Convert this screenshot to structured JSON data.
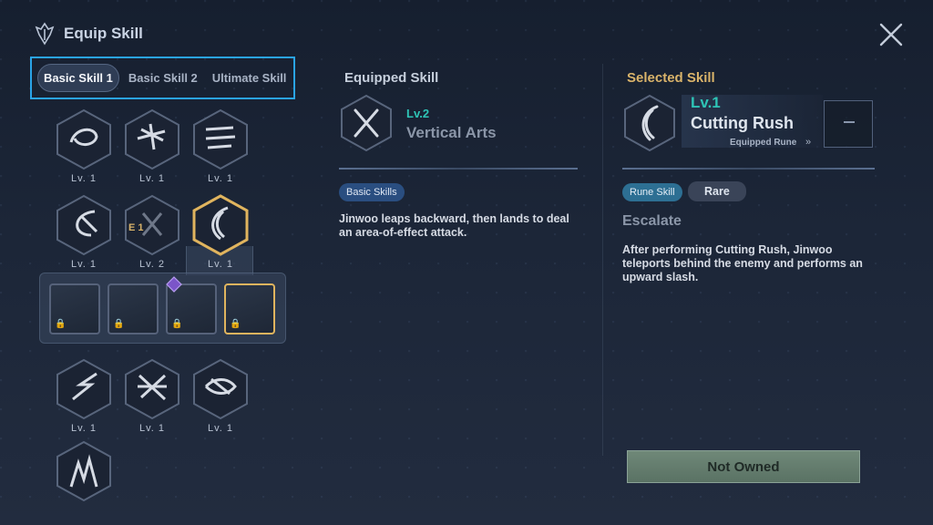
{
  "header": {
    "title": "Equip Skill",
    "logo_icon": "shield-emblem-icon",
    "close_icon": "close-x-icon"
  },
  "tabs": [
    {
      "label": "Basic Skill 1",
      "active": true
    },
    {
      "label": "Basic Skill 2",
      "active": false
    },
    {
      "label": "Ultimate Skill",
      "active": false
    }
  ],
  "skills": [
    {
      "level": "Lv. 1",
      "icon": "swirl-slash-icon"
    },
    {
      "level": "Lv. 1",
      "icon": "burst-dash-icon"
    },
    {
      "level": "Lv. 1",
      "icon": "triple-claw-icon"
    },
    {
      "level": "Lv. 1",
      "icon": "spiral-strike-icon"
    },
    {
      "level": "Lv. 2",
      "icon": "cross-slash-icon",
      "badge": "E 1"
    },
    {
      "level": "Lv. 1",
      "icon": "crescent-slash-icon",
      "selected": true
    },
    {
      "level": "Lv. 1",
      "icon": "lightning-slash-icon"
    },
    {
      "level": "Lv. 1",
      "icon": "star-slash-icon"
    },
    {
      "level": "Lv. 1",
      "icon": "whirlwind-icon"
    },
    {
      "level": "",
      "icon": "eruption-icon"
    }
  ],
  "runes": [
    {
      "locked": true
    },
    {
      "locked": true
    },
    {
      "locked": true,
      "gem": "purple-gem-icon"
    },
    {
      "locked": true,
      "selected": true
    }
  ],
  "equipped": {
    "section_label": "Equipped Skill",
    "level": "Lv.2",
    "name": "Vertical Arts",
    "tag": "Basic Skills",
    "description": "Jinwoo leaps backward, then lands to deal an area-of-effect attack."
  },
  "selected": {
    "section_label": "Selected Skill",
    "level": "Lv.1",
    "name": "Cutting Rush",
    "rune_label": "Equipped Rune",
    "rune_value": "–",
    "tag": "Rune Skill",
    "rarity": "Rare",
    "rune_name": "Escalate",
    "description": "After performing Cutting Rush, Jinwoo teleports behind the enemy and performs an upward slash."
  },
  "action": {
    "label": "Not Owned"
  },
  "colors": {
    "accent_blue": "#2aa4e8",
    "gold": "#e0b45e",
    "teal": "#2ec4b6",
    "section_gold": "#d9b36a"
  }
}
